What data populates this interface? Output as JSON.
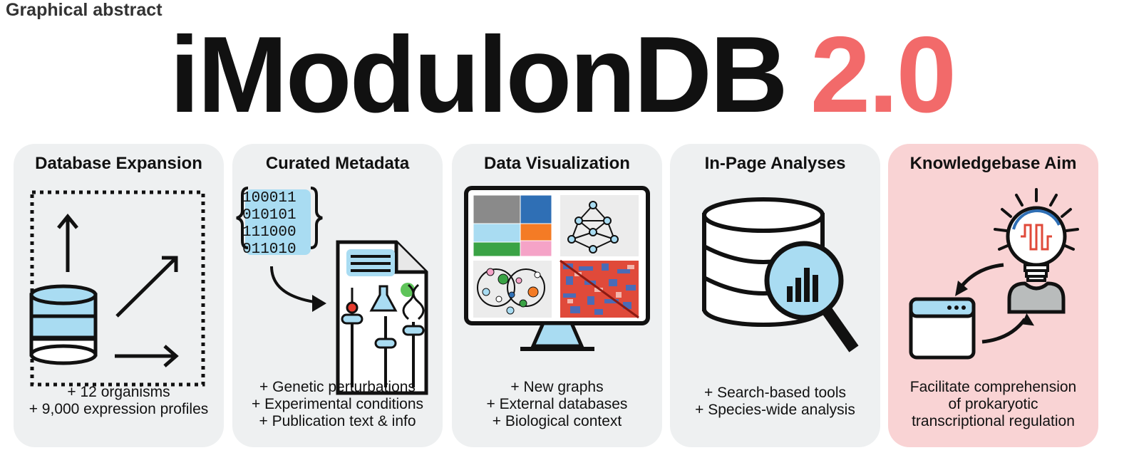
{
  "header": {
    "section_label": "Graphical abstract",
    "title_name": "iModulonDB",
    "title_version": "2.0"
  },
  "panels": [
    {
      "title": "Database Expansion",
      "icon": "database-expansion-icon",
      "lines": [
        "+ 12 organisms",
        "+ 9,000 expression profiles"
      ]
    },
    {
      "title": "Curated Metadata",
      "icon": "curated-metadata-icon",
      "binary": [
        "100011",
        "010101",
        "111000",
        "011010"
      ],
      "lines": [
        "+ Genetic perturbations",
        "+ Experimental conditions",
        "+ Publication text & info"
      ]
    },
    {
      "title": "Data Visualization",
      "icon": "monitor-graphs-icon",
      "lines": [
        "+ New graphs",
        "+ External databases",
        "+ Biological context"
      ]
    },
    {
      "title": "In-Page Analyses",
      "icon": "database-search-icon",
      "lines": [
        "+ Search-based tools",
        "+ Species-wide analysis"
      ]
    },
    {
      "title": "Knowledgebase Aim",
      "icon": "lightbulb-cycle-icon",
      "lines": [
        "Facilitate comprehension",
        "of prokaryotic",
        "transcriptional regulation"
      ]
    }
  ],
  "colors": {
    "accent_red": "#f26a6a",
    "panel_gray": "#eef0f1",
    "panel_pink": "#f9d3d4",
    "light_blue": "#a9dcf2"
  }
}
